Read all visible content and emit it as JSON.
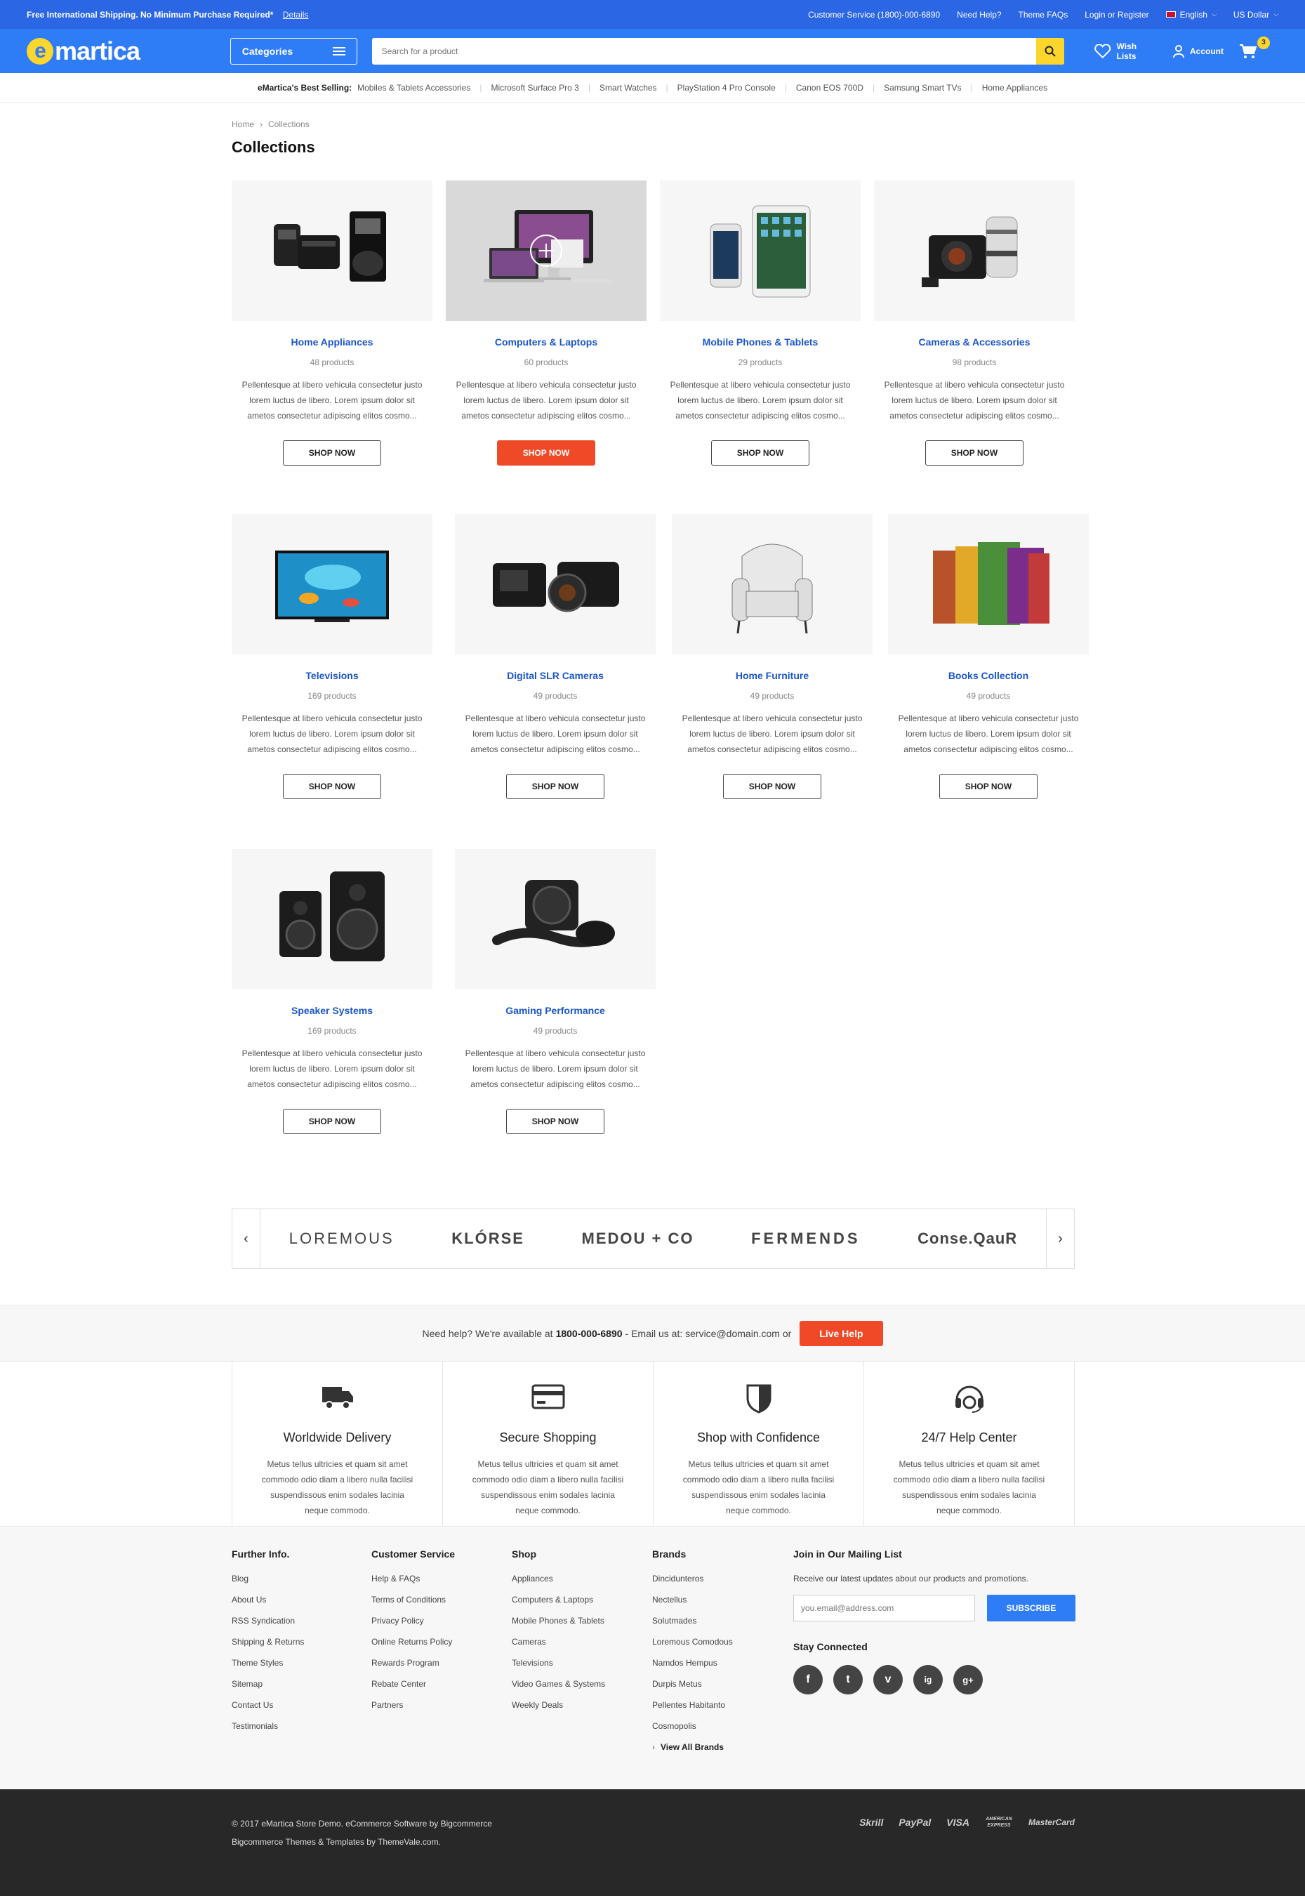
{
  "topbar": {
    "promo": "Free International Shipping. No Minimum Purchase Required*",
    "details_link": "Details",
    "customer_service": "Customer Service (1800)-000-6890",
    "need_help": "Need Help?",
    "theme_faqs": "Theme FAQs",
    "login": "Login or Register",
    "language": "English",
    "currency": "US Dollar"
  },
  "header": {
    "logo_letter": "e",
    "logo_text": "martica",
    "categories_label": "Categories",
    "search_placeholder": "Search for a product",
    "wishlist_label": "Wish Lists",
    "account_label": "Account",
    "cart_count": "3"
  },
  "bestselling": {
    "label": "eMartica's Best Selling:",
    "items": [
      "Mobiles & Tablets Accessories",
      "Microsoft Surface Pro 3",
      "Smart Watches",
      "PlayStation 4 Pro Console",
      "Canon EOS 700D",
      "Samsung Smart TVs",
      "Home Appliances"
    ]
  },
  "breadcrumb": {
    "home": "Home",
    "current": "Collections"
  },
  "page_title": "Collections",
  "collections": [
    {
      "name": "Home Appliances",
      "count": "48 products",
      "icon": "appliances-image"
    },
    {
      "name": "Computers & Laptops",
      "count": "60 products",
      "icon": "computers-image"
    },
    {
      "name": "Mobile Phones & Tablets",
      "count": "29 products",
      "icon": "phones-image"
    },
    {
      "name": "Cameras & Accessories",
      "count": "98 products",
      "icon": "cameras-image"
    },
    {
      "name": "Televisions",
      "count": "169 products",
      "icon": "tv-image"
    },
    {
      "name": "Digital SLR Cameras",
      "count": "49 products",
      "icon": "dslr-image"
    },
    {
      "name": "Home Furniture",
      "count": "49 products",
      "icon": "chair-image"
    },
    {
      "name": "Books Collection",
      "count": "49 products",
      "icon": "books-image"
    },
    {
      "name": "Speaker Systems",
      "count": "169 products",
      "icon": "speakers-image"
    },
    {
      "name": "Gaming Performance",
      "count": "49 products",
      "icon": "gaming-image"
    }
  ],
  "collection_desc": "Pellentesque at libero vehicula consectetur justo lorem luctus de libero. Lorem ipsum dolor sit ametos consectetur adipiscing elitos cosmo...",
  "shop_now": "SHOP NOW",
  "brands": [
    "LOREMOUS",
    "KLÓRSE",
    "MEDOU + CO",
    "FERMENDS",
    "Conse.QauR"
  ],
  "help": {
    "text1": "Need help? We're available at",
    "phone": "1800-000-6890",
    "text2": "- Email us at: service@domain.com or",
    "live_help": "Live Help"
  },
  "features": [
    {
      "title": "Worldwide Delivery",
      "desc": "Metus tellus ultricies et quam sit amet commodo odio diam a libero nulla facilisi suspendissous enim sodales lacinia neque commodo."
    },
    {
      "title": "Secure Shopping",
      "desc": "Metus tellus ultricies et quam sit amet commodo odio diam a libero nulla facilisi suspendissous enim sodales lacinia neque commodo."
    },
    {
      "title": "Shop with Confidence",
      "desc": "Metus tellus ultricies et quam sit amet commodo odio diam a libero nulla facilisi suspendissous enim sodales lacinia neque commodo."
    },
    {
      "title": "24/7 Help Center",
      "desc": "Metus tellus ultricies et quam sit amet commodo odio diam a libero nulla facilisi suspendissous enim sodales lacinia neque commodo."
    }
  ],
  "footer": {
    "further": {
      "title": "Further Info.",
      "links": [
        "Blog",
        "About Us",
        "RSS Syndication",
        "Shipping & Returns",
        "Theme Styles",
        "Sitemap",
        "Contact Us",
        "Testimonials"
      ]
    },
    "service": {
      "title": "Customer Service",
      "links": [
        "Help & FAQs",
        "Terms of Conditions",
        "Privacy Policy",
        "Online Returns Policy",
        "Rewards Program",
        "Rebate Center",
        "Partners"
      ]
    },
    "shop": {
      "title": "Shop",
      "links": [
        "Appliances",
        "Computers & Laptops",
        "Mobile Phones & Tablets",
        "Cameras",
        "Televisions",
        "Video Games & Systems",
        "Weekly Deals"
      ]
    },
    "brands": {
      "title": "Brands",
      "links": [
        "Dincidunteros",
        "Nectellus",
        "Solutmades",
        "Loremous Comodous",
        "Namdos Hempus",
        "Durpis Metus",
        "Pellentes Habitanto",
        "Cosmopolis"
      ],
      "view_all": "View All Brands"
    },
    "mailing": {
      "title": "Join in Our Mailing List",
      "text": "Receive our latest updates about our products and promotions.",
      "placeholder": "you.email@address.com",
      "subscribe": "SUBSCRIBE",
      "stay": "Stay Connected"
    },
    "social": [
      "f",
      "t",
      "v",
      "ig",
      "g+"
    ]
  },
  "bottom": {
    "copyright": "© 2017 eMartica Store Demo. eCommerce Software by Bigcommerce",
    "themes": "Bigcommerce Themes & Templates by ThemeVale.com.",
    "payments": [
      "Skrill",
      "PayPal",
      "VISA",
      "AMERICAN EXPRESS",
      "MasterCard"
    ]
  },
  "colors": {
    "brand_blue": "#2e7cf6",
    "topbar_blue": "#2b66e5",
    "accent_yellow": "#fcd62d",
    "cta_red": "#ef4a28",
    "link_blue": "#1a56c9"
  }
}
